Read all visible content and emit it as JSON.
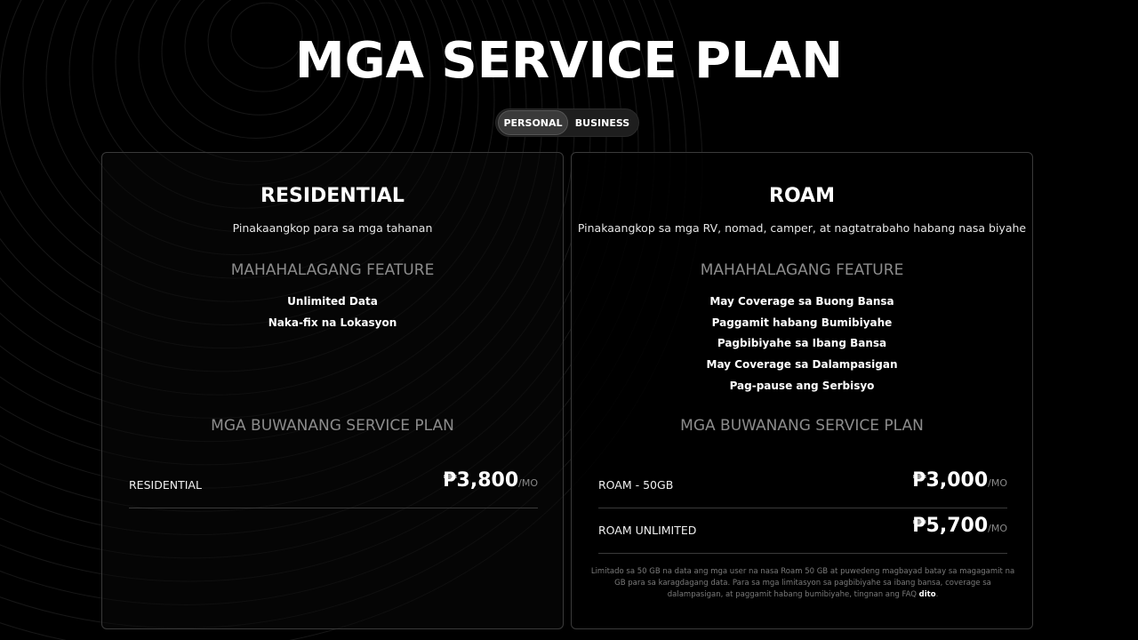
{
  "page": {
    "title": "MGA SERVICE PLAN"
  },
  "toggle": {
    "personal": "PERSONAL",
    "business": "BUSINESS",
    "active": "personal"
  },
  "plans": [
    {
      "title": "RESIDENTIAL",
      "subtitle": "Pinakaangkop para sa mga tahanan",
      "features_heading": "MAHAHALAGANG FEATURE",
      "features": [
        "Unlimited Data",
        "Naka-fix na Lokasyon"
      ],
      "monthly_heading": "MGA BUWANANG SERVICE PLAN",
      "options": [
        {
          "name": "RESIDENTIAL",
          "price": "₱3,800",
          "unit": "/MO"
        }
      ]
    },
    {
      "title": "ROAM",
      "subtitle": "Pinakaangkop sa mga RV, nomad, camper, at nagtatrabaho habang nasa biyahe",
      "features_heading": "MAHAHALAGANG FEATURE",
      "features": [
        "May Coverage sa Buong Bansa",
        "Paggamit habang Bumibiyahe",
        "Pagbibiyahe sa Ibang Bansa",
        "May Coverage sa Dalampasigan",
        "Pag-pause ang Serbisyo"
      ],
      "monthly_heading": "MGA BUWANANG SERVICE PLAN",
      "options": [
        {
          "name": "ROAM - 50GB",
          "price": "₱3,000",
          "unit": "/MO"
        },
        {
          "name": "ROAM UNLIMITED",
          "price": "₱5,700",
          "unit": "/MO"
        }
      ],
      "footnote": "Limitado sa 50 GB na data ang mga user na nasa Roam 50 GB at puwedeng magbayad batay sa magagamit na GB para sa karagdagang data. Para sa mga limitasyon sa pagbibiyahe sa ibang bansa, coverage sa dalampasigan, at paggamit habang bumibiyahe, tingnan ang FAQ ",
      "footnote_link": "dito",
      "footnote_end": "."
    }
  ],
  "colors": {
    "background": "#000000",
    "card_border": "#3a3a3a",
    "heading_muted": "#8c8c8c"
  }
}
